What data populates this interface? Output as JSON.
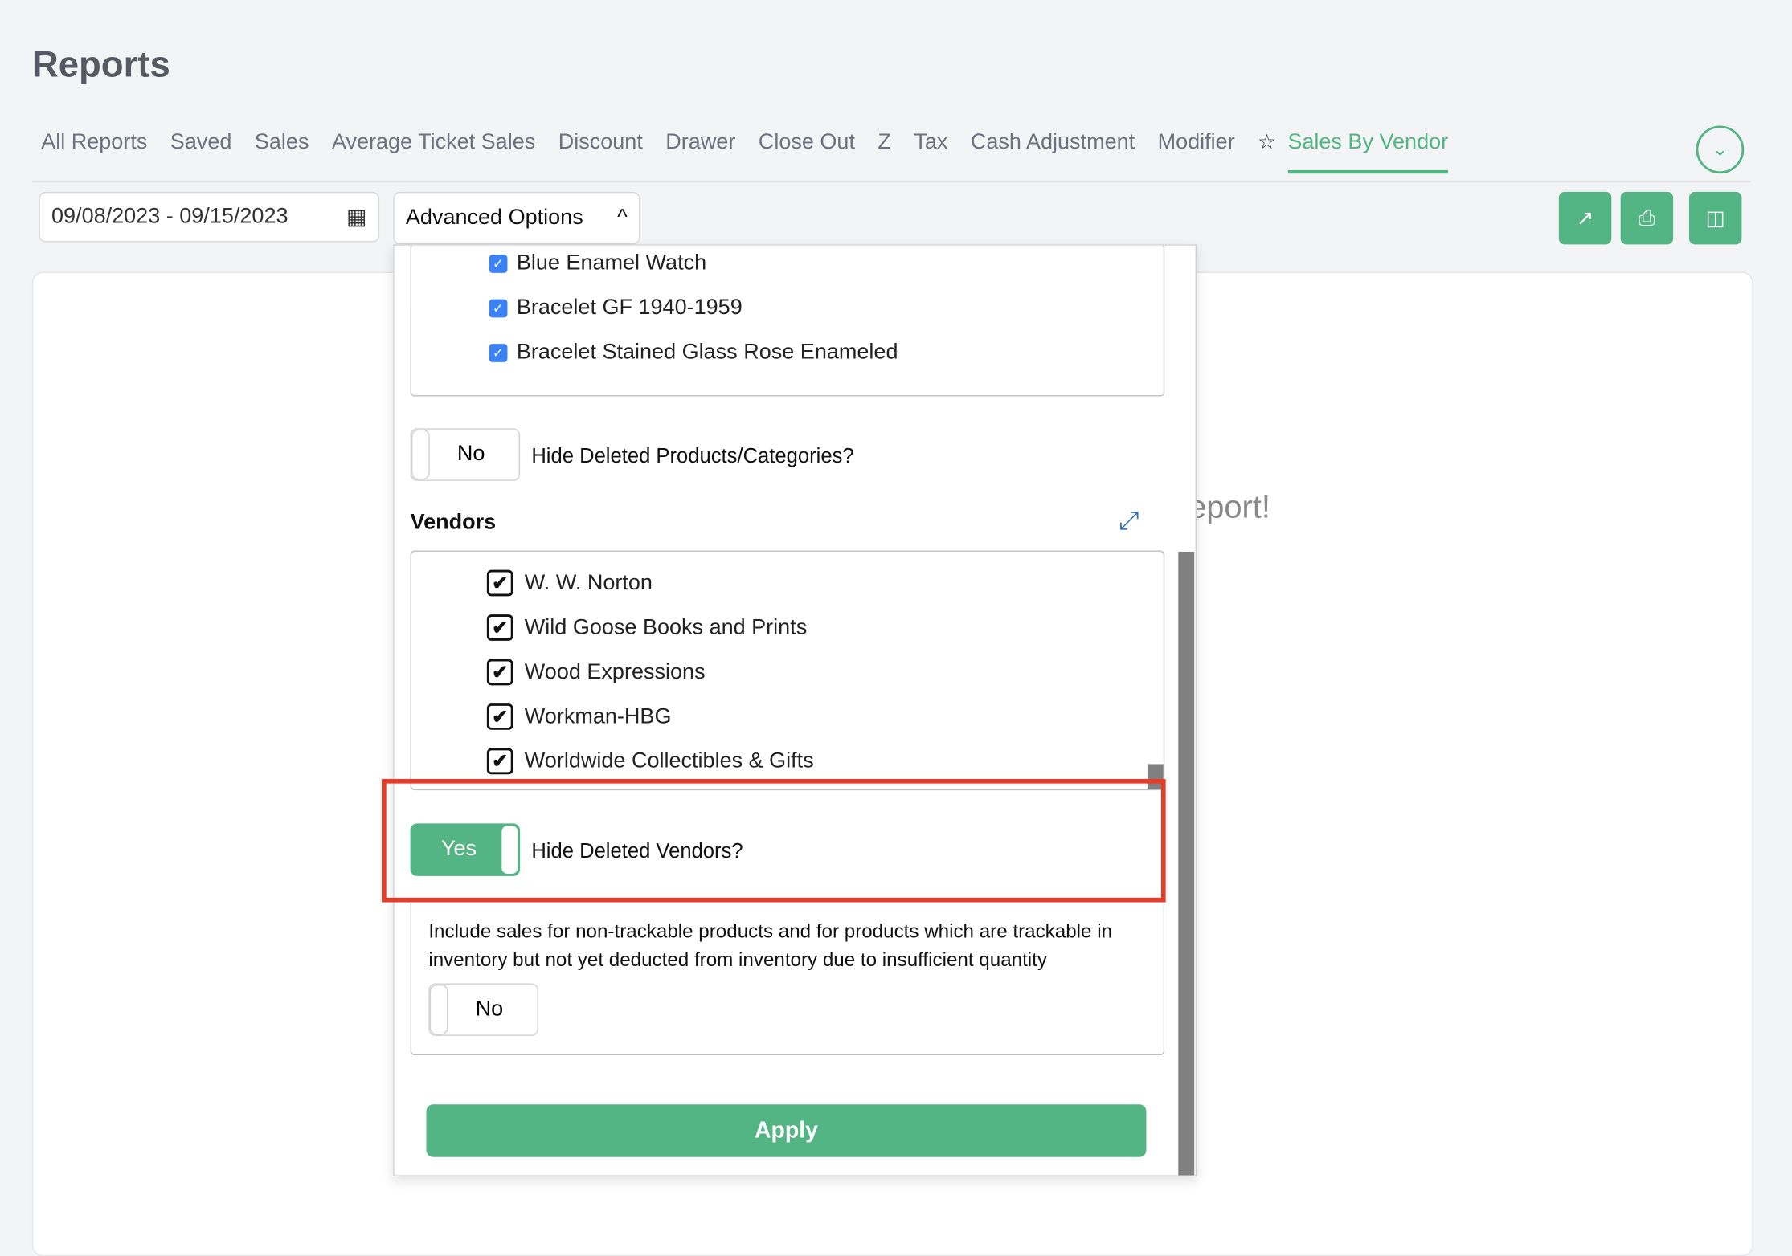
{
  "page_title": "Reports",
  "tabs": [
    {
      "label": "All Reports"
    },
    {
      "label": "Saved"
    },
    {
      "label": "Sales"
    },
    {
      "label": "Average Ticket Sales"
    },
    {
      "label": "Discount"
    },
    {
      "label": "Drawer"
    },
    {
      "label": "Close Out"
    },
    {
      "label": "Z"
    },
    {
      "label": "Tax"
    },
    {
      "label": "Cash Adjustment"
    },
    {
      "label": "Modifier"
    },
    {
      "label": "Sales By Vendor",
      "active": true,
      "starred": true
    }
  ],
  "icons": {
    "star": "☆",
    "chevron_down_circle": "⌄",
    "calendar": "▦",
    "chevron_up": "^",
    "share": "↗",
    "print": "⎙",
    "columns": "◫",
    "expand": "⤢",
    "check": "✓",
    "bold_check": "✔"
  },
  "toolbar": {
    "date_range": "09/08/2023 - 09/15/2023",
    "advanced_options_label": "Advanced Options"
  },
  "background_text": "eport!",
  "advanced": {
    "products": [
      {
        "label": "Blue Enamel Watch",
        "checked": true
      },
      {
        "label": "Bracelet GF 1940-1959",
        "checked": true
      },
      {
        "label": "Bracelet Stained Glass Rose Enameled",
        "checked": true
      }
    ],
    "hide_deleted_products": {
      "value": "No",
      "label": "Hide Deleted Products/Categories?"
    },
    "vendors_heading": "Vendors",
    "vendors": [
      {
        "label": "W. W. Norton",
        "checked": true
      },
      {
        "label": "Wild Goose Books and Prints",
        "checked": true
      },
      {
        "label": "Wood Expressions",
        "checked": true
      },
      {
        "label": "Workman-HBG",
        "checked": true
      },
      {
        "label": "Worldwide Collectibles & Gifts",
        "checked": true
      }
    ],
    "hide_deleted_vendors": {
      "value": "Yes",
      "label": "Hide Deleted Vendors?"
    },
    "include_nontrackable": {
      "text": "Include sales for non-trackable products and for products which are trackable in inventory but not yet deducted from inventory due to insufficient quantity",
      "value": "No"
    },
    "apply_label": "Apply"
  },
  "colors": {
    "accent": "#52b583",
    "highlight": "#e53d2a",
    "checkbox": "#3b82f6"
  }
}
